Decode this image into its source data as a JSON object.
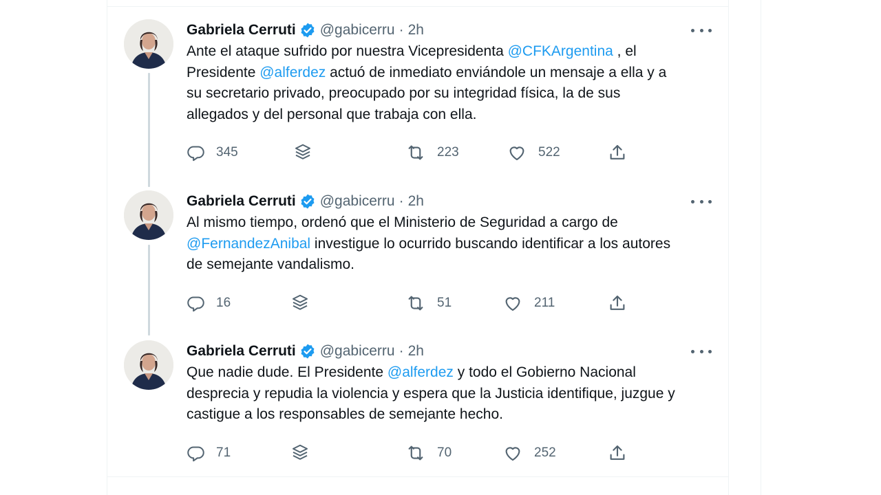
{
  "colors": {
    "text": "#0f1419",
    "secondary": "#536471",
    "link": "#1d9bf0",
    "verified": "#1d9bf0",
    "thread_line": "#cfd9de"
  },
  "icons": {
    "reply": "speech-bubble-icon",
    "stack": "layers-icon",
    "retweet": "retweet-icon",
    "like": "heart-icon",
    "share": "share-icon",
    "verified": "verified-badge-icon",
    "more": "more-dots-icon"
  },
  "tweets": [
    {
      "name": "Gabriela Cerruti",
      "handle": "@gabicerru",
      "separator": "·",
      "time": "2h",
      "body": {
        "t1": "Ante el ataque sufrido por nuestra Vicepresidenta ",
        "m1": "@CFKArgentina",
        "t2": " , el",
        "t3": "Presidente ",
        "m2": "@alferdez",
        "t4": " actuó de inmediato enviándole un mensaje a ella y a",
        "t5": "su secretario privado, preocupado por su integridad física,  la de sus",
        "t6": "allegados y del personal que trabaja con ella."
      },
      "replies": "345",
      "retweets": "223",
      "likes": "522"
    },
    {
      "name": "Gabriela Cerruti",
      "handle": "@gabicerru",
      "separator": "·",
      "time": "2h",
      "body": {
        "t1": "Al mismo tiempo, ordenó que el Ministerio de Seguridad a cargo de",
        "m1": "@FernandezAnibal",
        "t2": " investigue lo ocurrido buscando identificar a los autores",
        "t3": "de semejante vandalismo."
      },
      "replies": "16",
      "retweets": "51",
      "likes": "211"
    },
    {
      "name": "Gabriela Cerruti",
      "handle": "@gabicerru",
      "separator": "·",
      "time": "2h",
      "body": {
        "t1": "Que nadie dude. El Presidente ",
        "m1": "@alferdez",
        "t2": " y todo el Gobierno Nacional",
        "t3": "desprecia y repudia la violencia y espera que la Justicia identifique, juzgue y",
        "t4": "castigue a los responsables de semejante hecho."
      },
      "replies": "71",
      "retweets": "70",
      "likes": "252"
    }
  ]
}
